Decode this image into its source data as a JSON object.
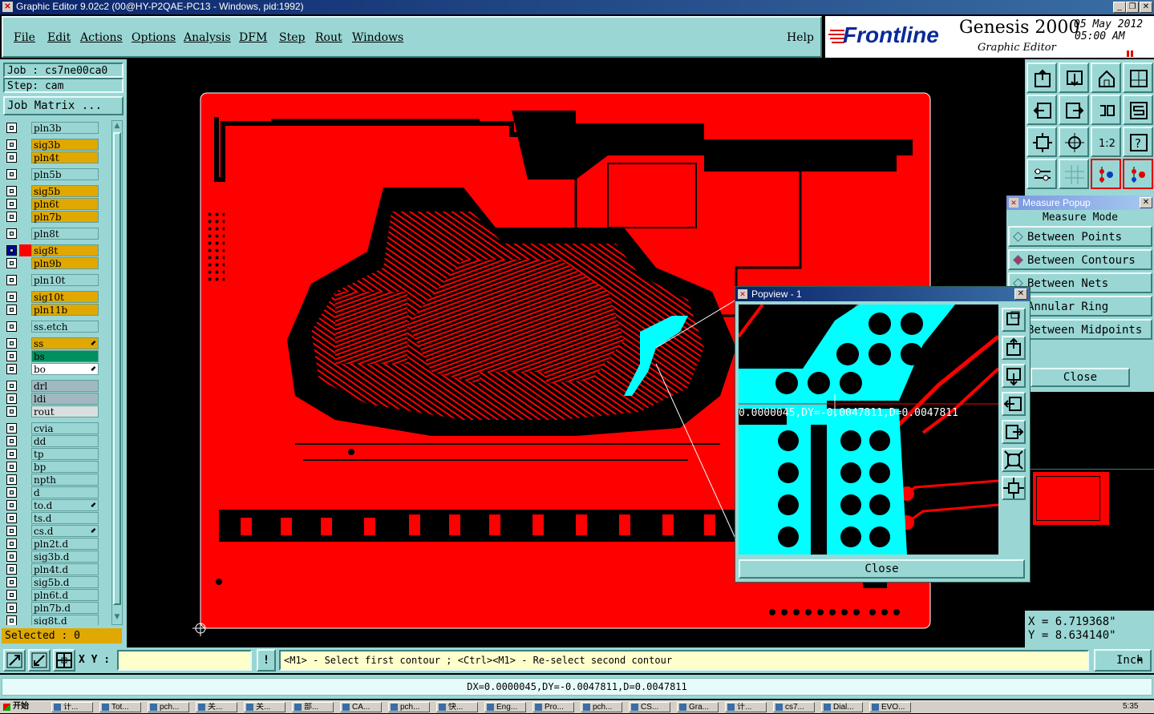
{
  "window": {
    "title": "Graphic Editor 9.02c2 (00@HY-P2QAE-PC13 - Windows, pid:1992)"
  },
  "menu": [
    "File",
    "Edit",
    "Actions",
    "Options",
    "Analysis",
    "DFM",
    "Step",
    "Rout",
    "Windows"
  ],
  "help": "Help",
  "logo": {
    "brand": "Frontline",
    "product": "Genesis 2000",
    "subtitle": "Graphic Editor",
    "date": "05 May 2012",
    "time": "05:00 AM"
  },
  "job": {
    "job": "Job : cs7ne00ca0",
    "step": "Step: cam",
    "matrix_button": "Job Matrix ..."
  },
  "layers": [
    {
      "name": "pln3b",
      "color": "#9ad7d4",
      "group": 0
    },
    {
      "name": "sig3b",
      "color": "#e0a800",
      "group": 1
    },
    {
      "name": "pln4t",
      "color": "#e0a800",
      "group": 1
    },
    {
      "name": "pln5b",
      "color": "#9ad7d4",
      "group": 2
    },
    {
      "name": "sig5b",
      "color": "#e0a800",
      "group": 3
    },
    {
      "name": "pln6t",
      "color": "#e0a800",
      "group": 3
    },
    {
      "name": "pln7b",
      "color": "#e0a800",
      "group": 3
    },
    {
      "name": "pln8t",
      "color": "#9ad7d4",
      "group": 4
    },
    {
      "name": "sig8t",
      "color": "#e0a800",
      "group": 5,
      "active": true
    },
    {
      "name": "pln9b",
      "color": "#e0a800",
      "group": 5
    },
    {
      "name": "pln10t",
      "color": "#9ad7d4",
      "group": 6
    },
    {
      "name": "sig10t",
      "color": "#e0a800",
      "group": 7
    },
    {
      "name": "pln11b",
      "color": "#e0a800",
      "group": 7
    },
    {
      "name": "ss.etch",
      "color": "#9ad7d4",
      "group": 8
    },
    {
      "name": "ss",
      "color": "#e0a800",
      "group": 9,
      "mark": "⬋"
    },
    {
      "name": "bs",
      "color": "#009060",
      "group": 9
    },
    {
      "name": "bo",
      "color": "#ffffff",
      "group": 9,
      "mark": "⬋"
    },
    {
      "name": "drl",
      "color": "#a0b8c0",
      "group": 10
    },
    {
      "name": "ldi",
      "color": "#a0b8c0",
      "group": 10
    },
    {
      "name": "rout",
      "color": "#d8e0e0",
      "group": 10
    },
    {
      "name": "cvia",
      "color": "#9ad7d4",
      "group": 11
    },
    {
      "name": "dd",
      "color": "#9ad7d4",
      "group": 11
    },
    {
      "name": "tp",
      "color": "#9ad7d4",
      "group": 11
    },
    {
      "name": "bp",
      "color": "#9ad7d4",
      "group": 11
    },
    {
      "name": "npth",
      "color": "#9ad7d4",
      "group": 11
    },
    {
      "name": "d",
      "color": "#9ad7d4",
      "group": 11
    },
    {
      "name": "to.d",
      "color": "#9ad7d4",
      "group": 11,
      "mark": "⬋"
    },
    {
      "name": "ts.d",
      "color": "#9ad7d4",
      "group": 11
    },
    {
      "name": "cs.d",
      "color": "#9ad7d4",
      "group": 11,
      "mark": "⬋"
    },
    {
      "name": "pln2t.d",
      "color": "#9ad7d4",
      "group": 11
    },
    {
      "name": "sig3b.d",
      "color": "#9ad7d4",
      "group": 11
    },
    {
      "name": "pln4t.d",
      "color": "#9ad7d4",
      "group": 11
    },
    {
      "name": "sig5b.d",
      "color": "#9ad7d4",
      "group": 11
    },
    {
      "name": "pln6t.d",
      "color": "#9ad7d4",
      "group": 11
    },
    {
      "name": "pln7b.d",
      "color": "#9ad7d4",
      "group": 11
    },
    {
      "name": "sig8t.d",
      "color": "#9ad7d4",
      "group": 11
    }
  ],
  "selected": "Selected : 0",
  "measure": {
    "title": "Measure Popup",
    "mode_label": "Measure Mode",
    "options": [
      "Between Points",
      "Between Contours",
      "Between Nets",
      "Annular Ring",
      "Between Midpoints"
    ],
    "selected_index": 1,
    "close": "Close"
  },
  "popview": {
    "title": "Popview - 1",
    "readout": "0.0000045,DY=-0.0047811,D=0.0047811",
    "close": "Close"
  },
  "coords": {
    "x": "X = 6.719368\"",
    "y": "Y = 8.634140\""
  },
  "xy_label": "X Y :",
  "xy_value": "",
  "prompt": "<M1> - Select first contour ; <Ctrl><M1> - Re-select second contour",
  "units": "Inch",
  "status": "DX=0.0000045,DY=-0.0047811,D=0.0047811",
  "taskbar": {
    "start": "开始",
    "tasks": [
      "计...",
      "Tot...",
      "pch...",
      "关...",
      "关...",
      "部...",
      "CA...",
      "pch...",
      "快...",
      "Eng...",
      "Pro...",
      "pch...",
      "CS...",
      "Gra...",
      "计...",
      "cs7...",
      "Dial...",
      "EVO..."
    ],
    "clock": "5:35"
  },
  "colors": {
    "panel": "#9ad7d4",
    "copper": "#ff0000",
    "highlight": "#00ffff",
    "active_layer": "#e0a800"
  }
}
